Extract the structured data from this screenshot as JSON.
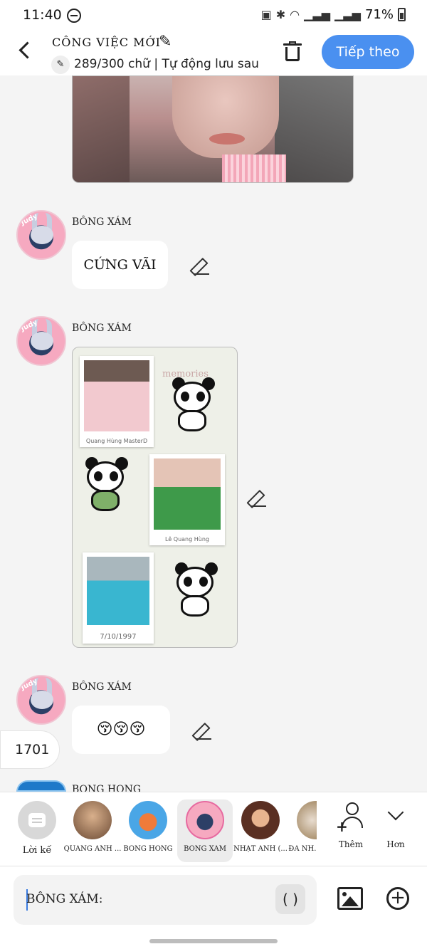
{
  "status": {
    "time": "11:40",
    "battery": "71%"
  },
  "header": {
    "title": "CÔNG VIỆC MỚI",
    "subtitle": "289/300 chữ | Tự động lưu sau",
    "next_label": "Tiếp theo"
  },
  "messages": [
    {
      "sender": "BÔNG XÁM",
      "text": "CỨNG VÃI"
    },
    {
      "sender": "BÔNG XÁM",
      "image_captions": [
        "Quang Hùng MasterD",
        "Lê Quang Hùng",
        "7/10/1997"
      ],
      "overlay_text": "memories"
    },
    {
      "sender": "BÔNG XÁM",
      "text": "😚😚😚"
    },
    {
      "sender": "BÔNG HỒNG"
    }
  ],
  "counter": "1701",
  "picker": {
    "items": [
      {
        "label": "Lời kế"
      },
      {
        "label": "QUANG ANH ..."
      },
      {
        "label": "BÔNG HỒNG"
      },
      {
        "label": "BÔNG XÁM"
      },
      {
        "label": "NHẬT ÁNH (..."
      },
      {
        "label": "ĐA NH..."
      }
    ],
    "more_label": "Thêm",
    "collapse_label": "Hơn"
  },
  "composer": {
    "value": "BÔNG XÁM:",
    "paren": "( )"
  }
}
